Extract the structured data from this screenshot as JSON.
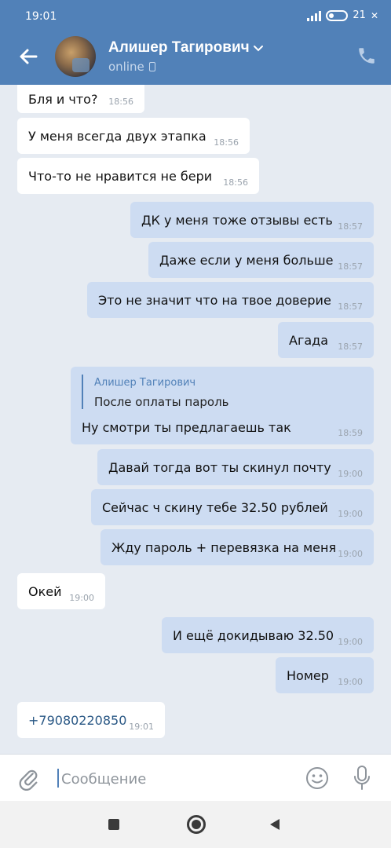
{
  "status_bar": {
    "time": "19:01",
    "battery": "21"
  },
  "header": {
    "name": "Алишер Тагирович",
    "status": "online"
  },
  "messages": [
    {
      "dir": "in",
      "text": "Бля и что?",
      "time": "18:56"
    },
    {
      "dir": "in",
      "text": "У меня всегда двух этапка",
      "time": "18:56"
    },
    {
      "dir": "in",
      "text": "Что-то не нравится не бери",
      "time": "18:56"
    },
    {
      "dir": "out",
      "text": "ДК у меня тоже отзывы есть",
      "time": "18:57"
    },
    {
      "dir": "out",
      "text": "Даже если у меня больше",
      "time": "18:57"
    },
    {
      "dir": "out",
      "text": "Это не значит что на твое доверие",
      "time": "18:57"
    },
    {
      "dir": "out",
      "text": "Агада",
      "time": "18:57"
    },
    {
      "dir": "out",
      "reply_author": "Алишер Тагирович",
      "reply_text": "После оплаты пароль",
      "text": "Ну смотри ты предлагаешь так",
      "time": "18:59"
    },
    {
      "dir": "out",
      "text": "Давай тогда вот ты скинул почту",
      "time": "19:00"
    },
    {
      "dir": "out",
      "text": "Сейчас ч скину тебе 32.50 рублей",
      "time": "19:00"
    },
    {
      "dir": "out",
      "text": "Жду пароль + перевязка на меня",
      "time": "19:00"
    },
    {
      "dir": "in",
      "text": "Окей",
      "time": "19:00"
    },
    {
      "dir": "out",
      "text": "И ещё докидываю 32.50",
      "time": "19:00"
    },
    {
      "dir": "out",
      "text": "Номер",
      "time": "19:00"
    },
    {
      "dir": "in",
      "text": "+79080220850",
      "time": "19:01"
    }
  ],
  "composer": {
    "placeholder": "Сообщение"
  },
  "colors": {
    "header": "#5181b8",
    "incoming": "#ffffff",
    "outgoing": "#cddcf2",
    "background": "#e6ebf2"
  }
}
